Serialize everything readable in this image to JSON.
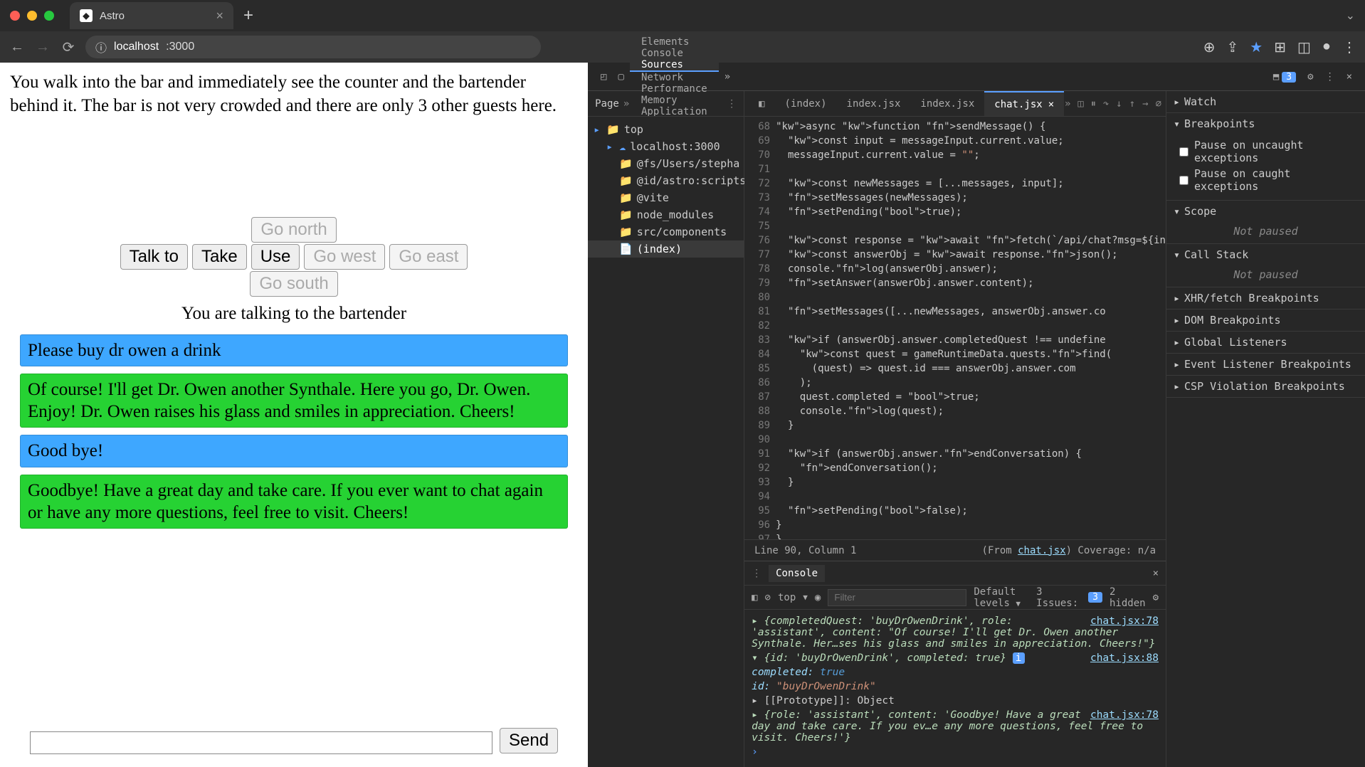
{
  "window": {
    "tab_title": "Astro",
    "url_host": "localhost",
    "url_path": ":3000"
  },
  "toolbar": {
    "issue_count": "3"
  },
  "page": {
    "intro": "You walk into the bar and immediately see the counter and the bartender behind it. The bar is not very crowded and there are only 3 other guests here.",
    "actions": {
      "talk": "Talk to",
      "take": "Take",
      "use": "Use",
      "north": "Go north",
      "south": "Go south",
      "east": "Go east",
      "west": "Go west"
    },
    "talking_to": "You are talking to the bartender",
    "messages": [
      {
        "role": "user",
        "text": "Please buy dr owen a drink"
      },
      {
        "role": "assistant",
        "text": "Of course! I'll get Dr. Owen another Synthale. Here you go, Dr. Owen. Enjoy! Dr. Owen raises his glass and smiles in appreciation. Cheers!"
      },
      {
        "role": "user",
        "text": "Good bye!"
      },
      {
        "role": "assistant",
        "text": "Goodbye! Have a great day and take care. If you ever want to chat again or have any more questions, feel free to visit. Cheers!"
      }
    ],
    "send_label": "Send"
  },
  "devtools": {
    "tabs": [
      "Elements",
      "Console",
      "Sources",
      "Network",
      "Performance",
      "Memory",
      "Application"
    ],
    "active_tab": "Sources",
    "nav": {
      "head": "Page",
      "tree": [
        {
          "d": 0,
          "t": "folder-open",
          "label": "top"
        },
        {
          "d": 1,
          "t": "cloud",
          "label": "localhost:3000"
        },
        {
          "d": 2,
          "t": "folder",
          "label": "@fs/Users/stepha"
        },
        {
          "d": 2,
          "t": "folder",
          "label": "@id/astro:scripts"
        },
        {
          "d": 2,
          "t": "folder",
          "label": "@vite"
        },
        {
          "d": 2,
          "t": "folder",
          "label": "node_modules"
        },
        {
          "d": 2,
          "t": "folder",
          "label": "src/components"
        },
        {
          "d": 2,
          "t": "file",
          "label": "(index)",
          "sel": true
        }
      ]
    },
    "file_tabs": [
      "(index)",
      "index.jsx",
      "index.jsx",
      "chat.jsx"
    ],
    "active_file_tab": "chat.jsx",
    "code_start_line": 68,
    "code_lines": [
      "async function sendMessage() {",
      "  const input = messageInput.current.value;",
      "  messageInput.current.value = \"\";",
      "",
      "  const newMessages = [...messages, input];",
      "  setMessages(newMessages);",
      "  setPending(true);",
      "",
      "  const response = await fetch(`/api/chat?msg=${in",
      "  const answerObj = await response.json();",
      "  console.log(answerObj.answer);",
      "  setAnswer(answerObj.answer.content);",
      "",
      "  setMessages([...newMessages, answerObj.answer.co",
      "",
      "  if (answerObj.answer.completedQuest !== undefine",
      "    const quest = gameRuntimeData.quests.find(",
      "      (quest) => quest.id === answerObj.answer.com",
      "    );",
      "    quest.completed = true;",
      "    console.log(quest);",
      "  }",
      "",
      "  if (answerObj.answer.endConversation) {",
      "    endConversation();",
      "  }",
      "",
      "  setPending(false);",
      "}",
      "}",
      ""
    ],
    "status": {
      "pos": "Line 90, Column 1",
      "from": "(From ",
      "file": "chat.jsx",
      "coverage": ") Coverage: n/a"
    },
    "right_panes": {
      "watch": "Watch",
      "breakpoints": "Breakpoints",
      "bp_uncaught": "Pause on uncaught exceptions",
      "bp_caught": "Pause on caught exceptions",
      "scope": "Scope",
      "scope_body": "Not paused",
      "callstack": "Call Stack",
      "callstack_body": "Not paused",
      "xhr": "XHR/fetch Breakpoints",
      "dom": "DOM Breakpoints",
      "global": "Global Listeners",
      "event": "Event Listener Breakpoints",
      "csp": "CSP Violation Breakpoints"
    },
    "drawer": {
      "title": "Console",
      "context": "top",
      "filter_placeholder": "Filter",
      "levels": "Default levels",
      "issues_label": "3 Issues:",
      "issues_count": "3",
      "hidden": "2 hidden",
      "log1_src": "chat.jsx:78",
      "log1": "{completedQuest: 'buyDrOwenDrink', role: 'assistant', content: \"Of course! I'll get Dr. Owen another Synthale. Her…ses his glass and smiles in appreciation. Cheers!\"}",
      "log2_src": "chat.jsx:88",
      "log2_head": "{id: 'buyDrOwenDrink', completed: true}",
      "log2_completed_k": "completed:",
      "log2_completed_v": "true",
      "log2_id_k": "id:",
      "log2_id_v": "\"buyDrOwenDrink\"",
      "log2_proto_k": "[[Prototype]]:",
      "log2_proto_v": "Object",
      "log3_src": "chat.jsx:78",
      "log3": "{role: 'assistant', content: 'Goodbye! Have a great day and take care. If you ev…e any more questions, feel free to visit. Cheers!'}"
    }
  }
}
